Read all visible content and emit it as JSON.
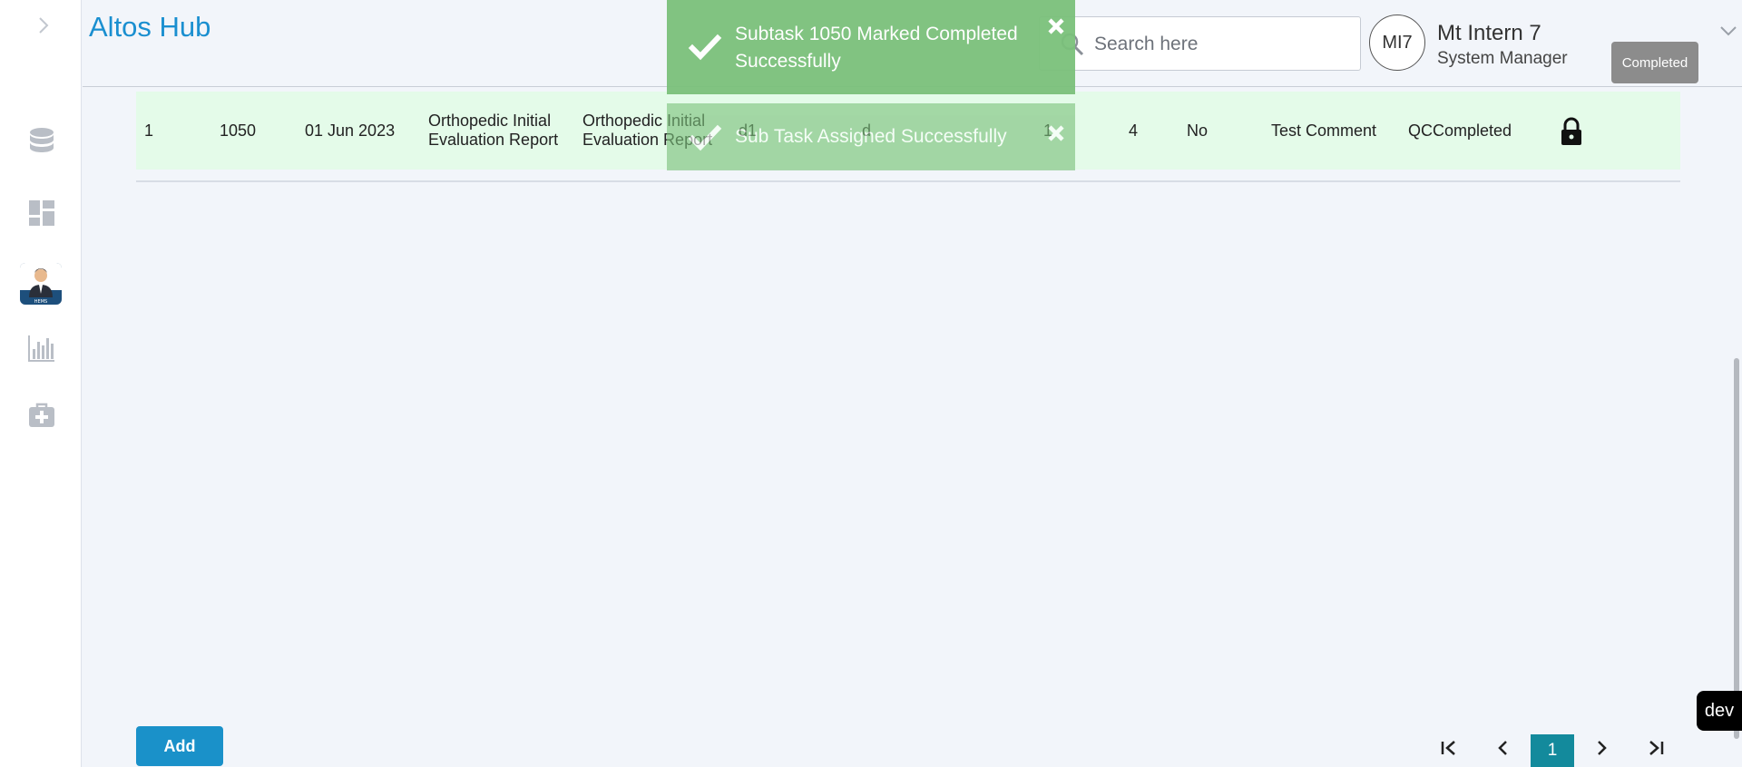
{
  "app": {
    "title": "Altos Hub"
  },
  "header": {
    "search": {
      "placeholder": "Search here",
      "value": ""
    },
    "user": {
      "initials": "MI7",
      "name": "Mt Intern 7",
      "role": "System Manager"
    },
    "tooltip": "Completed"
  },
  "sidebar": {
    "items": [
      {
        "icon": "database-icon"
      },
      {
        "icon": "dashboard-icon"
      },
      {
        "icon": "user-avatar-icon",
        "label": "HEMS"
      },
      {
        "icon": "bar-chart-icon"
      },
      {
        "icon": "medical-kit-icon"
      }
    ]
  },
  "toasts": [
    {
      "text": "Subtask 1050 Marked Completed Successfully"
    },
    {
      "text": "Sub Task Assigned Successfully"
    }
  ],
  "table": {
    "rows": [
      {
        "index": "1",
        "id": "1050",
        "date": "01 Jun 2023",
        "report_type": "Orthopedic Initial Evaluation Report",
        "report_name": "Orthopedic Initial Evaluation Report",
        "code": "d1",
        "note": "d",
        "count_a": "1",
        "count_b": "4",
        "flag": "No",
        "comment": "Test Comment",
        "status": "QCCompleted"
      }
    ]
  },
  "pagination": {
    "current_page": "1"
  },
  "footer": {
    "add_label": "Add",
    "env_badge": "dev"
  }
}
